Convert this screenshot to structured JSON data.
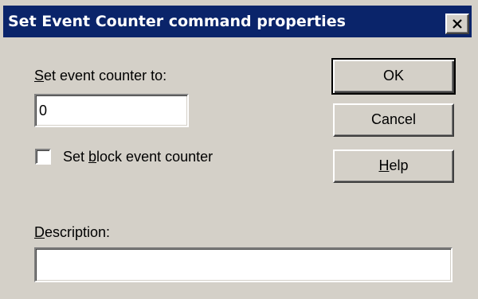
{
  "dialog": {
    "title": "Set Event Counter command properties",
    "close_label": "×"
  },
  "counter": {
    "label_prefix": "",
    "label_underlined": "S",
    "label_rest": "et event counter to:",
    "value": "0"
  },
  "block_checkbox": {
    "checked": false,
    "label_prefix": "Set ",
    "label_underlined": "b",
    "label_rest": "lock event counter"
  },
  "buttons": {
    "ok_label": "OK",
    "cancel_label": "Cancel",
    "help_prefix": "",
    "help_underlined": "H",
    "help_rest": "elp"
  },
  "description": {
    "label_prefix": "",
    "label_underlined": "D",
    "label_rest": "escription:",
    "value": ""
  },
  "colors": {
    "dialog_bg": "#d4d0c8",
    "titlebar_bg": "#0a246a",
    "title_text": "#ffffff"
  }
}
